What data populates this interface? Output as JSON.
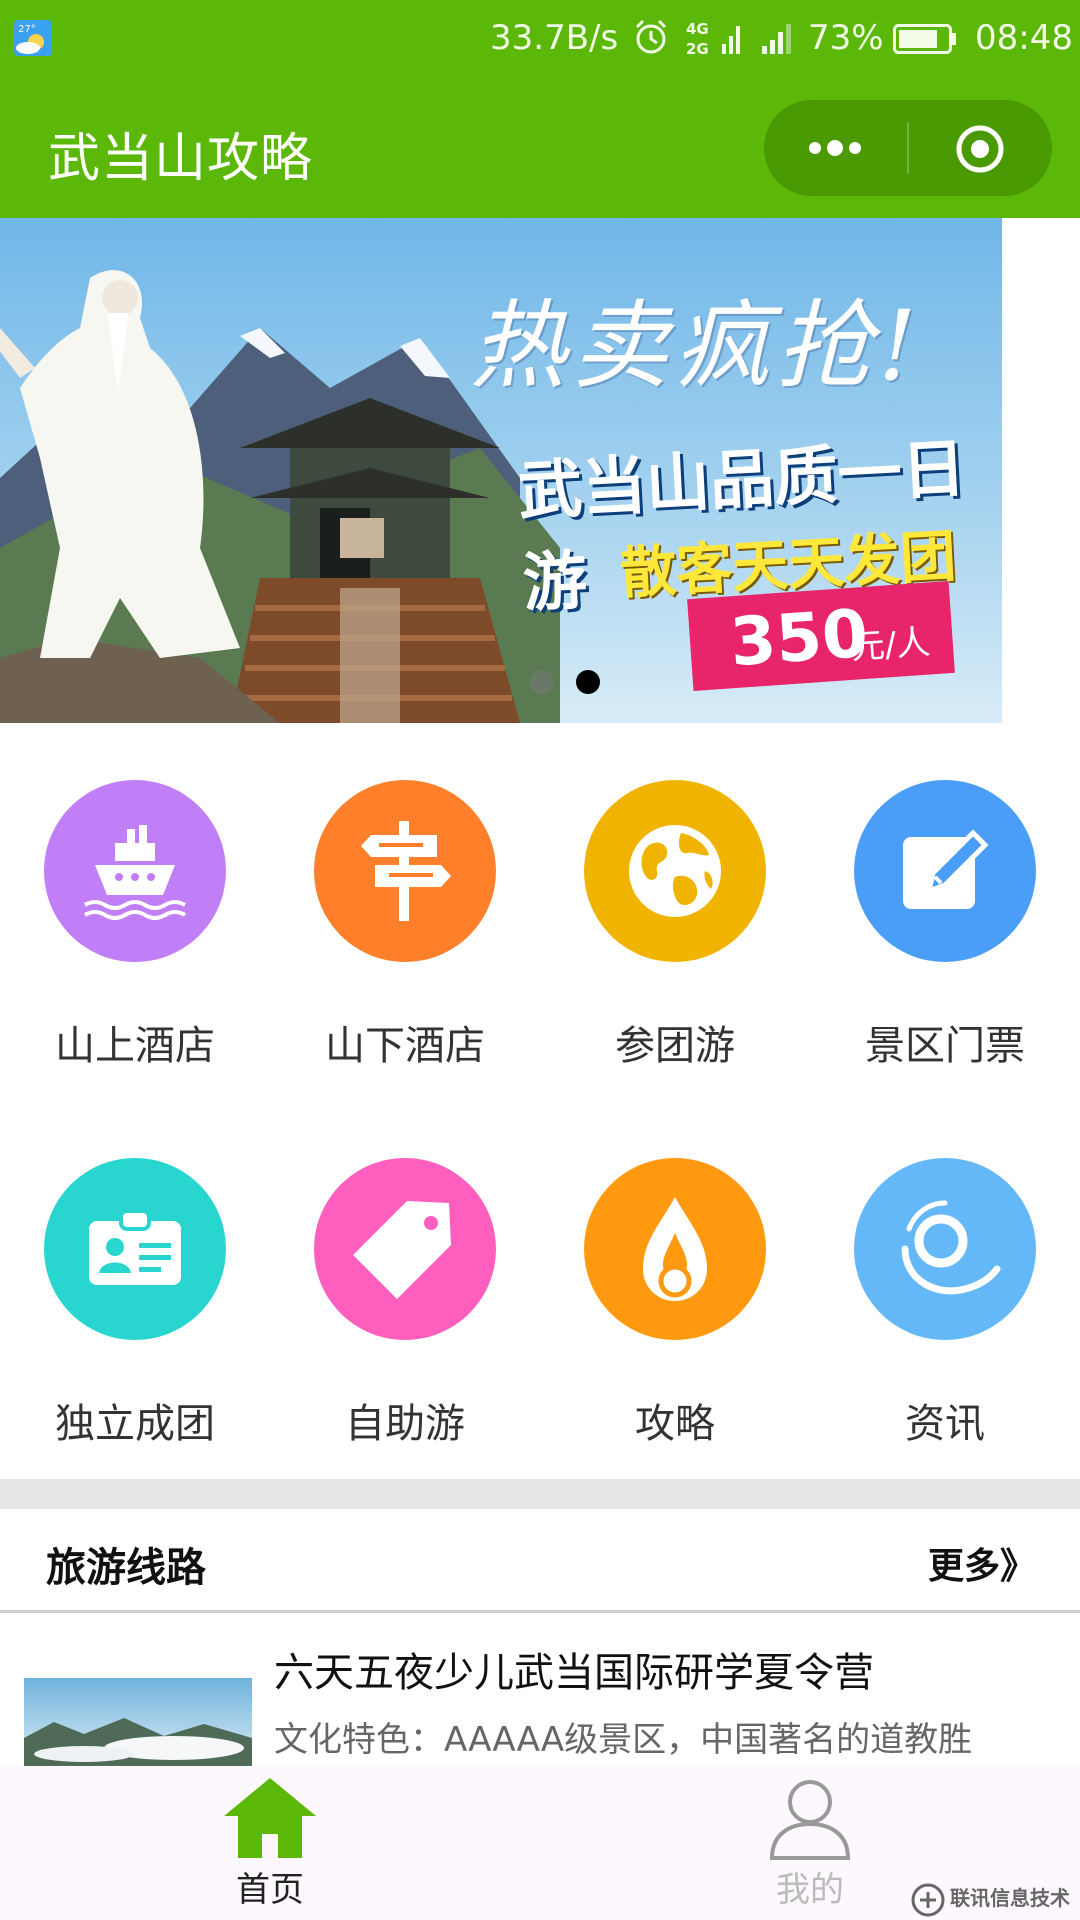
{
  "status_bar": {
    "net_speed": "33.7B/s",
    "network_top": "4G",
    "network_bottom": "2G",
    "battery_percent": "73%",
    "time": "08:48",
    "weather_temp": "27°"
  },
  "header": {
    "title": "武当山攻略",
    "bar_color": "#5cb808"
  },
  "banner": {
    "headline": "热卖疯抢!",
    "subtitle": "武当山品质一日游",
    "tagline": "散客天天发团",
    "price": "350",
    "price_unit": "元/人",
    "active_dot": 2,
    "dot_count": 2
  },
  "categories": [
    {
      "label": "山上酒店",
      "icon": "ship-icon",
      "color": "#c07ef7"
    },
    {
      "label": "山下酒店",
      "icon": "signpost-icon",
      "color": "#ff7f2a"
    },
    {
      "label": "参团游",
      "icon": "globe-icon",
      "color": "#f0b400"
    },
    {
      "label": "景区门票",
      "icon": "edit-icon",
      "color": "#4b9ef8"
    },
    {
      "label": "独立成团",
      "icon": "id-card-icon",
      "color": "#29d6cf"
    },
    {
      "label": "自助游",
      "icon": "tag-icon",
      "color": "#fe5fbf"
    },
    {
      "label": "攻略",
      "icon": "flame-icon",
      "color": "#ff9a10"
    },
    {
      "label": "资讯",
      "icon": "swirl-icon",
      "color": "#64b8f8"
    }
  ],
  "routes_section": {
    "title": "旅游线路",
    "more_label": "更多》"
  },
  "routes": [
    {
      "title": "六天五夜少儿武当国际研学夏令营",
      "desc": "文化特色：AAAAA级景区，中国著名的道教胜"
    }
  ],
  "tabbar": {
    "home_label": "首页",
    "mine_label": "我的",
    "active_color": "#5cb808"
  },
  "watermark": "联讯信息技术"
}
